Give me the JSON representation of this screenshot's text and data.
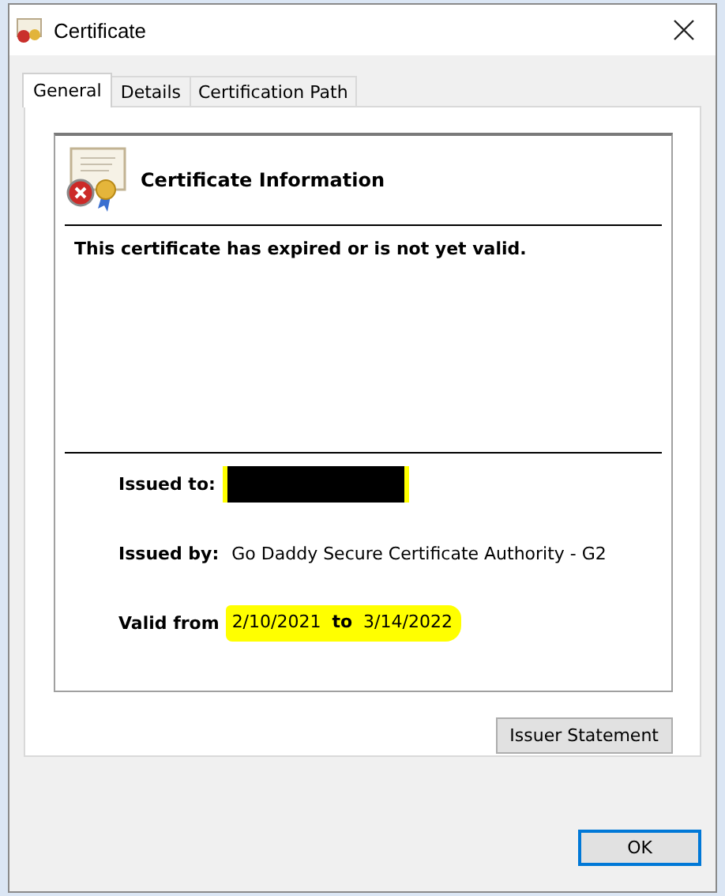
{
  "window": {
    "title": "Certificate"
  },
  "tabs": [
    {
      "label": "General",
      "selected": true
    },
    {
      "label": "Details",
      "selected": false
    },
    {
      "label": "Certification Path",
      "selected": false
    }
  ],
  "info": {
    "heading": "Certificate Information",
    "status": "This certificate has expired or is not yet valid.",
    "invalid": true
  },
  "issued_to": {
    "label": "Issued to:",
    "redacted": true,
    "highlighted": true
  },
  "issued_by": {
    "label": "Issued by:",
    "value": "Go Daddy Secure Certificate Authority - G2"
  },
  "validity": {
    "label": "Valid from",
    "from": "2/10/2021",
    "to_label": "to",
    "to": "3/14/2022",
    "highlighted": true
  },
  "buttons": [
    {
      "label": "Issuer Statement",
      "kind": "panel"
    },
    {
      "label": "OK",
      "kind": "dialog",
      "default": true
    }
  ]
}
